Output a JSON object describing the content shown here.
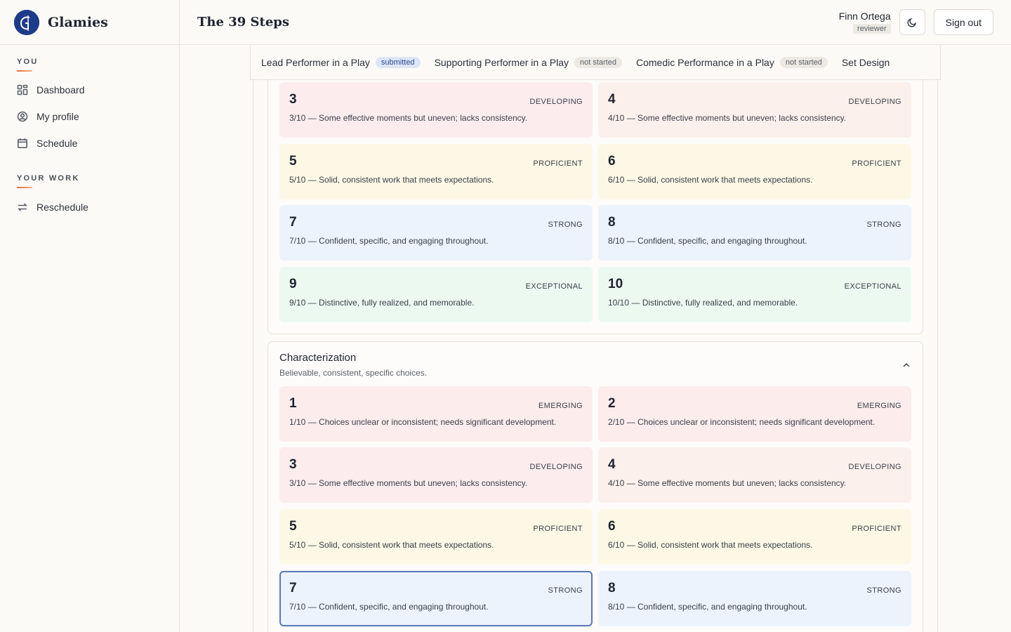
{
  "brand": {
    "name": "Glamies"
  },
  "sidebar": {
    "sections": [
      {
        "label": "YOU",
        "items": [
          {
            "label": "Dashboard",
            "icon": "dashboard-icon"
          },
          {
            "label": "My profile",
            "icon": "user-circle-icon"
          },
          {
            "label": "Schedule",
            "icon": "calendar-icon"
          }
        ]
      },
      {
        "label": "YOUR WORK",
        "items": [
          {
            "label": "Reschedule",
            "icon": "swap-arrows-icon"
          }
        ]
      }
    ]
  },
  "header": {
    "title": "The 39 Steps",
    "user_name": "Finn Ortega",
    "user_role": "reviewer",
    "theme_toggle_icon": "moon-icon",
    "sign_out_label": "Sign out"
  },
  "tabs": [
    {
      "label": "Lead Performer in a Play",
      "status": "submitted"
    },
    {
      "label": "Supporting Performer in a Play",
      "status": "not started"
    },
    {
      "label": "Comedic Performance in a Play",
      "status": "not started"
    },
    {
      "label": "Set Design",
      "status": ""
    }
  ],
  "top_panel": {
    "cards": [
      {
        "score": "3",
        "level": "DEVELOPING",
        "desc": "3/10 — Some effective moments but uneven; lacks consistency."
      },
      {
        "score": "4",
        "level": "DEVELOPING",
        "desc": "4/10 — Some effective moments but uneven; lacks consistency."
      },
      {
        "score": "5",
        "level": "PROFICIENT",
        "desc": "5/10 — Solid, consistent work that meets expectations."
      },
      {
        "score": "6",
        "level": "PROFICIENT",
        "desc": "6/10 — Solid, consistent work that meets expectations."
      },
      {
        "score": "7",
        "level": "STRONG",
        "desc": "7/10 — Confident, specific, and engaging throughout."
      },
      {
        "score": "8",
        "level": "STRONG",
        "desc": "8/10 — Confident, specific, and engaging throughout."
      },
      {
        "score": "9",
        "level": "EXCEPTIONAL",
        "desc": "9/10 — Distinctive, fully realized, and memorable."
      },
      {
        "score": "10",
        "level": "EXCEPTIONAL",
        "desc": "10/10 — Distinctive, fully realized, and memorable."
      }
    ]
  },
  "characterization": {
    "title": "Characterization",
    "subtitle": "Believable, consistent, specific choices.",
    "selected_score": "7",
    "cards": [
      {
        "score": "1",
        "level": "EMERGING",
        "desc": "1/10 — Choices unclear or inconsistent; needs significant development."
      },
      {
        "score": "2",
        "level": "EMERGING",
        "desc": "2/10 — Choices unclear or inconsistent; needs significant development."
      },
      {
        "score": "3",
        "level": "DEVELOPING",
        "desc": "3/10 — Some effective moments but uneven; lacks consistency."
      },
      {
        "score": "4",
        "level": "DEVELOPING",
        "desc": "4/10 — Some effective moments but uneven; lacks consistency."
      },
      {
        "score": "5",
        "level": "PROFICIENT",
        "desc": "5/10 — Solid, consistent work that meets expectations."
      },
      {
        "score": "6",
        "level": "PROFICIENT",
        "desc": "6/10 — Solid, consistent work that meets expectations."
      },
      {
        "score": "7",
        "level": "STRONG",
        "desc": "7/10 — Confident, specific, and engaging throughout."
      },
      {
        "score": "8",
        "level": "STRONG",
        "desc": "8/10 — Confident, specific, and engaging throughout."
      }
    ]
  }
}
